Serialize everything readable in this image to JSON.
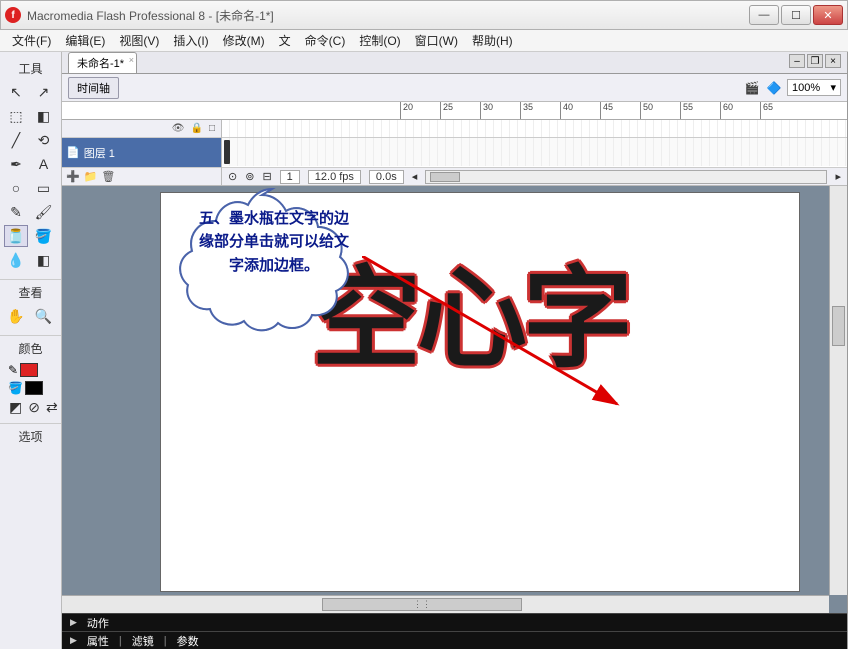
{
  "window": {
    "app_title": "Macromedia Flash Professional 8 - [未命名-1*]",
    "doc_tab": "未命名-1*"
  },
  "menu": {
    "file": "文件(F)",
    "edit": "编辑(E)",
    "view": "视图(V)",
    "insert": "插入(I)",
    "modify": "修改(M)",
    "text": "文",
    "commands": "命令(C)",
    "control": "控制(O)",
    "window": "窗口(W)",
    "help": "帮助(H)"
  },
  "toolbox": {
    "tools_label": "工具",
    "view_label": "查看",
    "colors_label": "颜色",
    "options_label": "选项"
  },
  "timeline": {
    "button_label": "时间轴",
    "zoom": "100%",
    "layer_name": "图层 1",
    "frame_num": "1",
    "fps": "12.0 fps",
    "elapsed": "0.0s"
  },
  "ruler_ticks": [
    "20",
    "25",
    "30",
    "35",
    "40",
    "45",
    "50",
    "55",
    "60",
    "65"
  ],
  "stage": {
    "text": "空心字"
  },
  "callout": {
    "text": "五、墨水瓶在文字的边缘部分单击就可以给文字添加边框。"
  },
  "panels": {
    "actions": "动作",
    "props": "属性",
    "filters": "滤镜",
    "params": "参数"
  }
}
